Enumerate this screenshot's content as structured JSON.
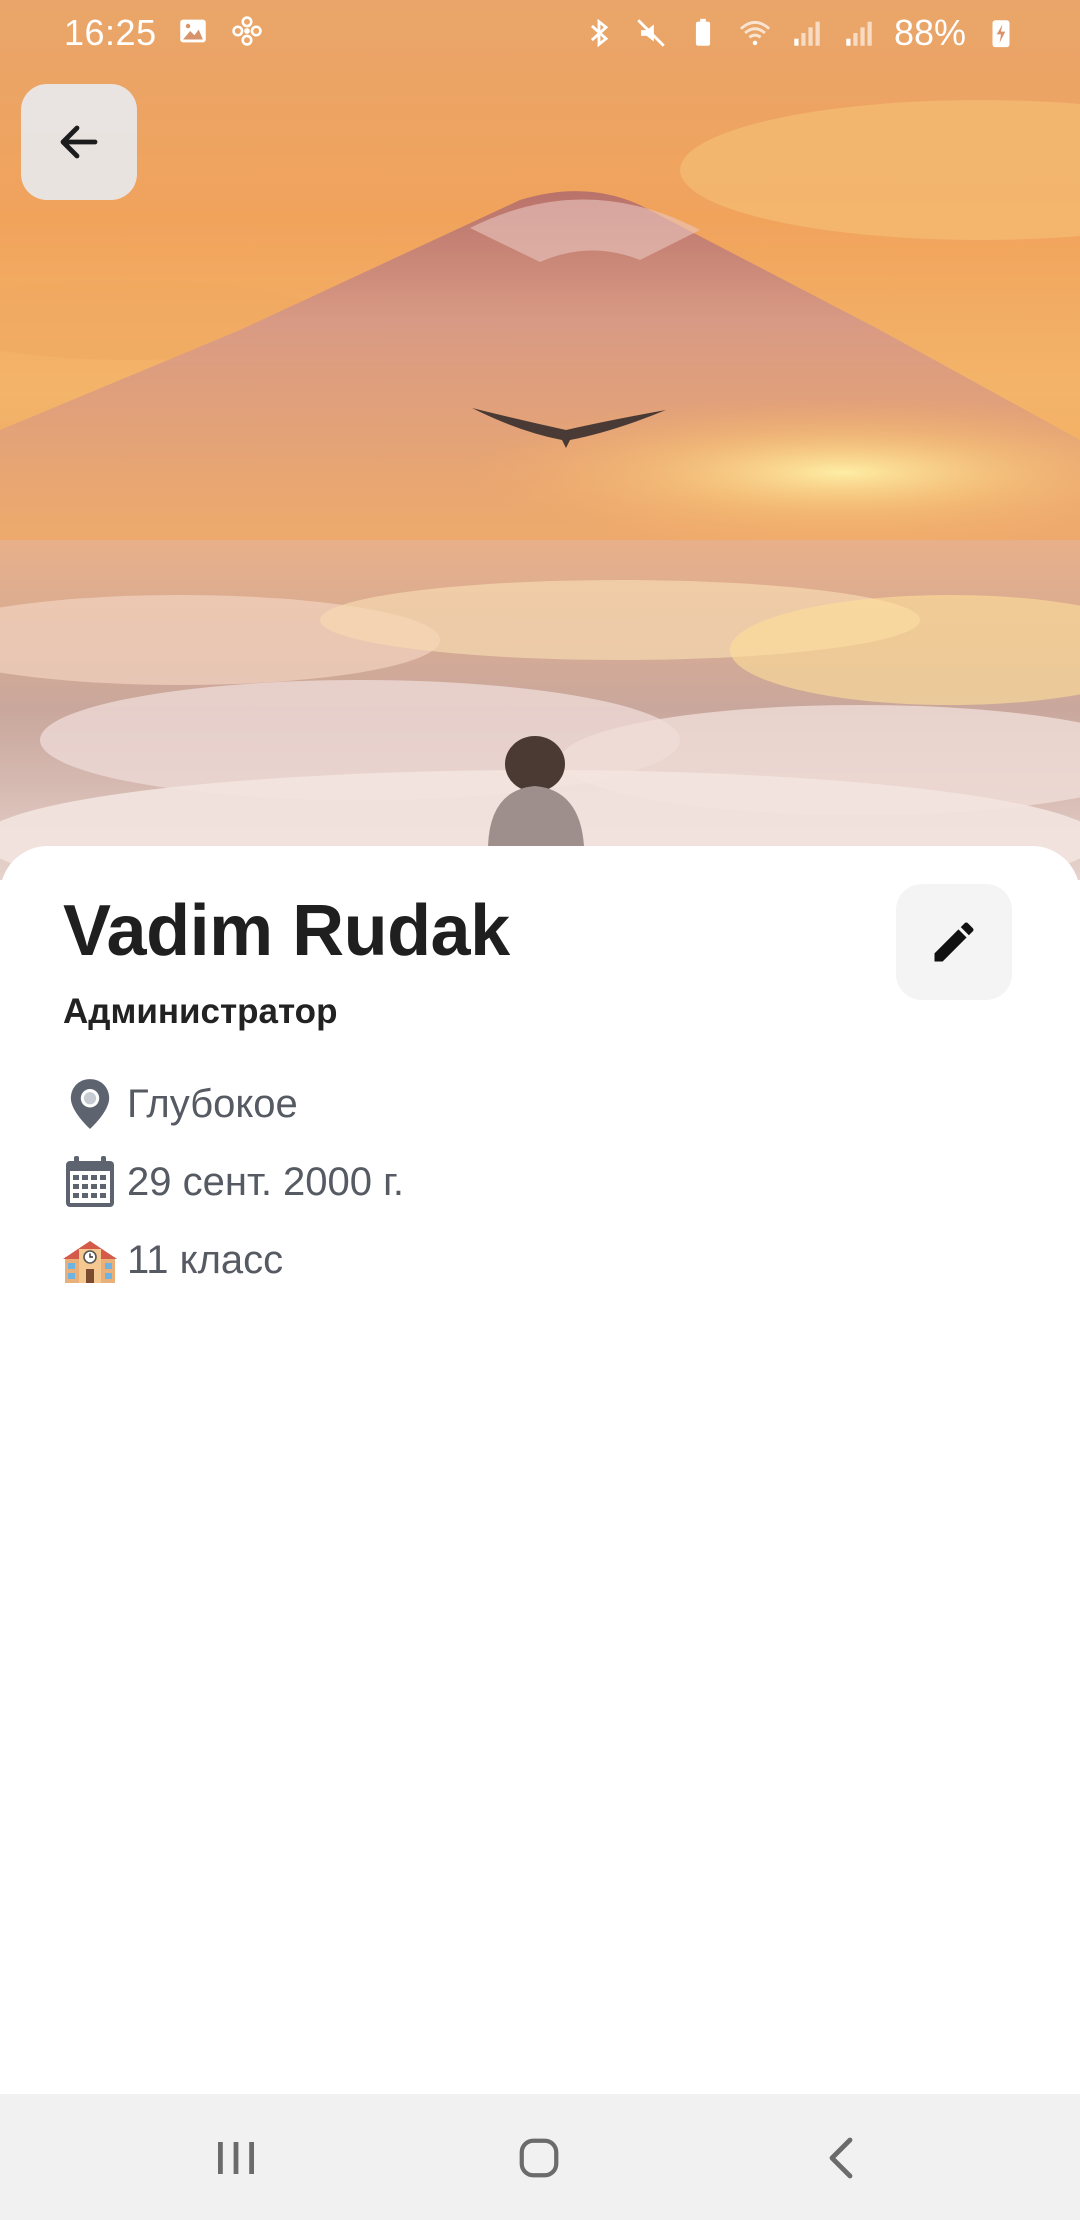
{
  "status_bar": {
    "time": "16:25",
    "battery": "88%",
    "left_icons": [
      "gallery-icon",
      "fan-icon"
    ],
    "right_icons": [
      "bluetooth-icon",
      "mute-icon",
      "battery-saver-icon",
      "wifi-icon",
      "signal-icon",
      "signal-icon",
      "battery-charging-icon"
    ]
  },
  "header": {
    "back_icon": "arrow-left-icon"
  },
  "profile": {
    "name": "Vadim Rudak",
    "role": "Администратор",
    "edit_icon": "pencil-icon",
    "details": [
      {
        "icon": "location-pin-icon",
        "text": "Глубокое"
      },
      {
        "icon": "calendar-icon",
        "text": "29 сент. 2000 г."
      },
      {
        "icon": "school-icon",
        "text": "11 класс"
      }
    ]
  },
  "nav_bar": {
    "buttons": [
      "recents-icon",
      "home-icon",
      "back-chevron-icon"
    ]
  },
  "colors": {
    "card_background": "#ffffff",
    "name_text": "#1f1f1f",
    "detail_text": "#555a63",
    "nav_background": "#f1f1f2"
  }
}
